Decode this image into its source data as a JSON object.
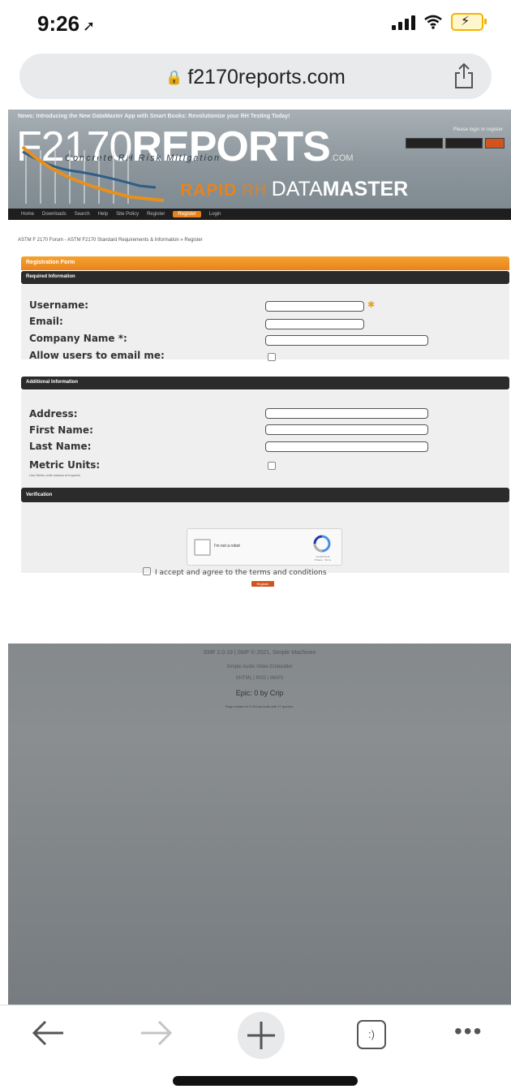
{
  "status_bar": {
    "time": "9:26",
    "location_icon": "location-arrow-icon",
    "signal_icon": "signal-bars-icon",
    "wifi_icon": "wifi-icon",
    "battery_icon": "battery-charging-icon"
  },
  "browser": {
    "url": "f2170reports.com",
    "lock_icon": "lock-icon",
    "share_icon": "share-icon"
  },
  "site": {
    "news_ticker": "News: Introducing the New DataMaster App with Smart Books: Revolutionize your RH Testing Today!",
    "logo_light": "F2170",
    "logo_bold": "REPORTS",
    "logo_suffix": ".COM",
    "tagline": "Concrete RH Risk Mitigation",
    "login_hint": "Please login or register",
    "product_rapid": "RAPID",
    "product_rh": "RH",
    "product_data": "DATA",
    "product_master": "MASTER"
  },
  "nav": {
    "items": [
      "Home",
      "Downloads",
      "Search",
      "Help",
      "Site Policy",
      "Register",
      "Register",
      "Login"
    ],
    "active_index": 6
  },
  "breadcrumb": "ASTM F 2170 Forum - ASTM F2170 Standard Requirements & Information » Register",
  "form": {
    "title": "Registration Form",
    "required_section": {
      "title": "Required Information",
      "username_label": "Username:",
      "email_label": "Email:",
      "company_label": "Company Name *:",
      "allow_email_label": "Allow users to email me:"
    },
    "additional_section": {
      "title": "Additional Information",
      "address_label": "Address:",
      "first_name_label": "First Name:",
      "last_name_label": "Last Name:",
      "metric_label": "Metric Units:",
      "metric_sub": "Use Metric units instead of Imperial"
    },
    "verification_section": {
      "title": "Verification",
      "captcha_text": "I'm not a robot",
      "captcha_brand": "reCAPTCHA",
      "captcha_links": "Privacy - Terms"
    },
    "terms_text": "I accept and agree to the terms and conditions",
    "register_button": "Register"
  },
  "footer": {
    "line1": "SMF 2.0.19 | SMF © 2021, Simple Machines",
    "line2": "Simple Audio Video Embedder",
    "line3": "XHTML | RSS | WAP2",
    "line4": "Epic: 0 by Crip",
    "line5": "Page created in 0.034 seconds with 17 queries."
  },
  "toolbar": {
    "back_icon": "back-arrow-icon",
    "forward_icon": "forward-arrow-icon",
    "new_tab_icon": "plus-icon",
    "tabs_icon": "tabs-icon",
    "tabs_glyph": ":)",
    "more_icon": "more-icon"
  }
}
